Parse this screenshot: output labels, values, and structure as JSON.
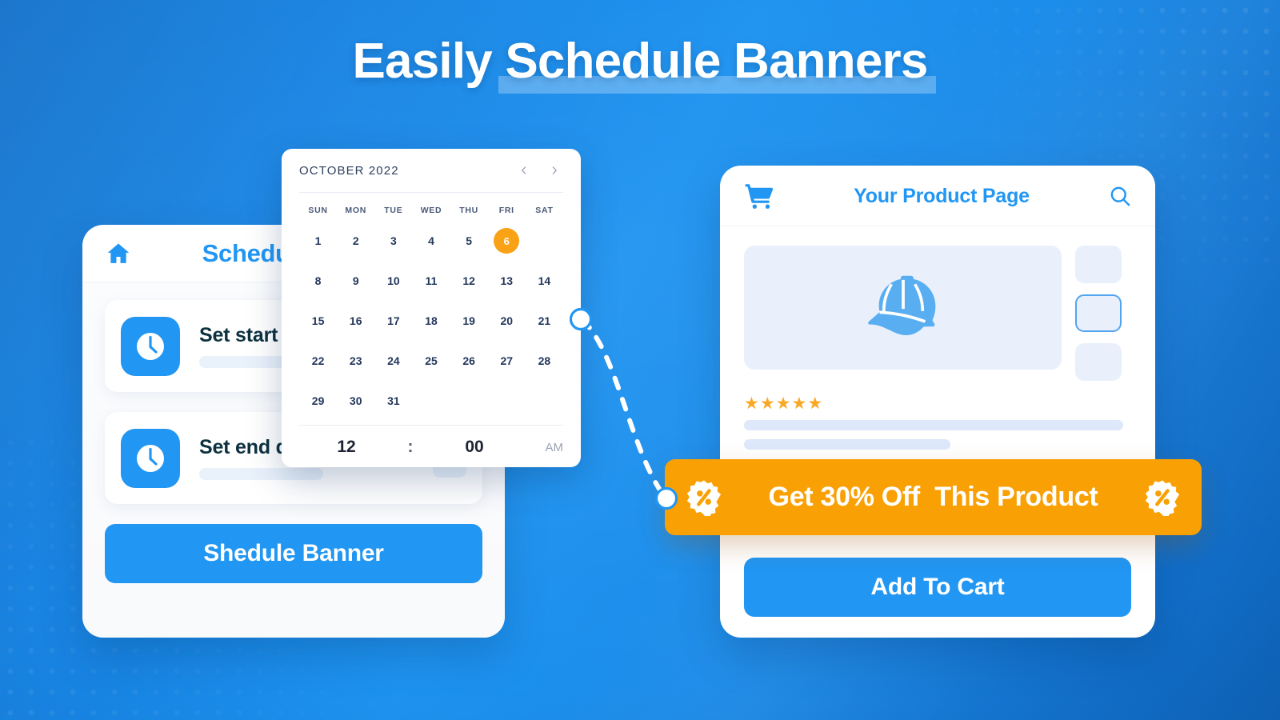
{
  "hero": {
    "title": "Easily Schedule Banners",
    "highlight_segment": "Schedule Banners"
  },
  "colors": {
    "background_blue": "#1180e0",
    "accent_blue": "#2196f3",
    "promo_orange": "#f9a005",
    "selected_day_orange": "#f9a215",
    "star_amber": "#f9a826",
    "dark_text": "#0d3140"
  },
  "scheduler": {
    "home_icon": "home-icon",
    "title": "Schedule Banner",
    "fields": [
      {
        "icon": "clock-icon",
        "label": "Set start date:",
        "value": "",
        "has_dropdown": false
      },
      {
        "icon": "clock-icon",
        "label": "Set end date:",
        "value": "",
        "has_dropdown": true,
        "dropdown_icon": "chevron-down-icon"
      }
    ],
    "submit_label": "Shedule Banner"
  },
  "calendar": {
    "month_year": "OCTOBER  2022",
    "prev_icon": "chevron-left-icon",
    "next_icon": "chevron-right-icon",
    "weekday_labels": [
      "SUN",
      "MON",
      "TUE",
      "WED",
      "THU",
      "FRI",
      "SAT"
    ],
    "weeks": [
      [
        "1",
        "2",
        "3",
        "4",
        "5",
        "6",
        ""
      ],
      [
        "8",
        "9",
        "10",
        "11",
        "12",
        "13",
        "14"
      ],
      [
        "15",
        "16",
        "17",
        "18",
        "19",
        "20",
        "21"
      ],
      [
        "22",
        "23",
        "24",
        "25",
        "26",
        "27",
        "28"
      ],
      [
        "29",
        "30",
        "31",
        "",
        "",
        "",
        ""
      ]
    ],
    "selected_day": "6",
    "time": {
      "hours": "12",
      "separator": ":",
      "minutes": "00",
      "meridiem": "AM"
    }
  },
  "product_page": {
    "cart_icon": "shopping-cart-icon",
    "title": "Your Product Page",
    "search_icon": "search-icon",
    "hero_image_icon": "baseball-cap-icon",
    "thumbnails": [
      {
        "name": "thumbnail-1",
        "selected": false
      },
      {
        "name": "thumbnail-2",
        "selected": true
      },
      {
        "name": "thumbnail-3",
        "selected": false
      }
    ],
    "rating_stars": 5,
    "star_glyph": "★",
    "add_to_cart_label": "Add To Cart"
  },
  "promo_banner": {
    "left_icon": "percent-badge-icon",
    "text": "Get 30% Off  This Product",
    "right_icon": "percent-badge-icon"
  }
}
